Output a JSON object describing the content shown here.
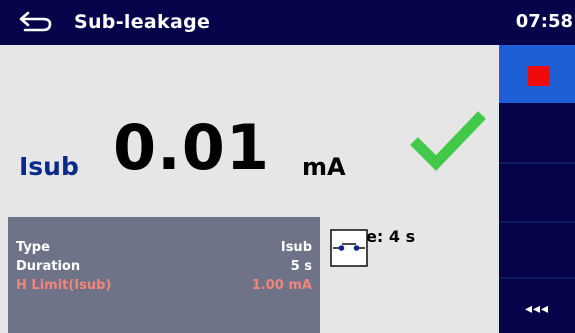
{
  "header": {
    "title": "Sub-leakage",
    "clock": "07:58"
  },
  "result": {
    "label": "Isub",
    "value": "0.01",
    "unit": "mA",
    "status": "pass"
  },
  "time": "Time: 4 s",
  "params": [
    {
      "name": "Type",
      "value": "Isub"
    },
    {
      "name": "Duration",
      "value": "5 s"
    },
    {
      "name": "H Limit(Isub)",
      "value": "1.00 mA"
    }
  ],
  "sidebar": {
    "more_label": "◂◂◂"
  },
  "colors": {
    "header_bg": "#05044a",
    "stop_button": "#1f5fd6",
    "stop_icon": "#ef0b0b",
    "pass_check": "#43c94a",
    "limit_text": "#f3847c"
  },
  "icons": {
    "back": "back-arrow-icon",
    "status": "check-icon",
    "stop": "stop-icon",
    "connection": "switch-icon",
    "more": "more-icon"
  }
}
